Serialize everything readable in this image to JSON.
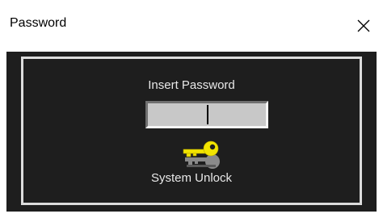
{
  "window": {
    "title": "Password",
    "close_icon": "close-icon"
  },
  "dialog": {
    "prompt": "Insert Password",
    "password_value": "",
    "key_icon": "key-icon",
    "unlock_label": "System Unlock"
  },
  "colors": {
    "background": "#1e1e1e",
    "panel_border": "#dcdcdc",
    "field": "#c8c8c8",
    "key_gold": "#f2e400"
  }
}
